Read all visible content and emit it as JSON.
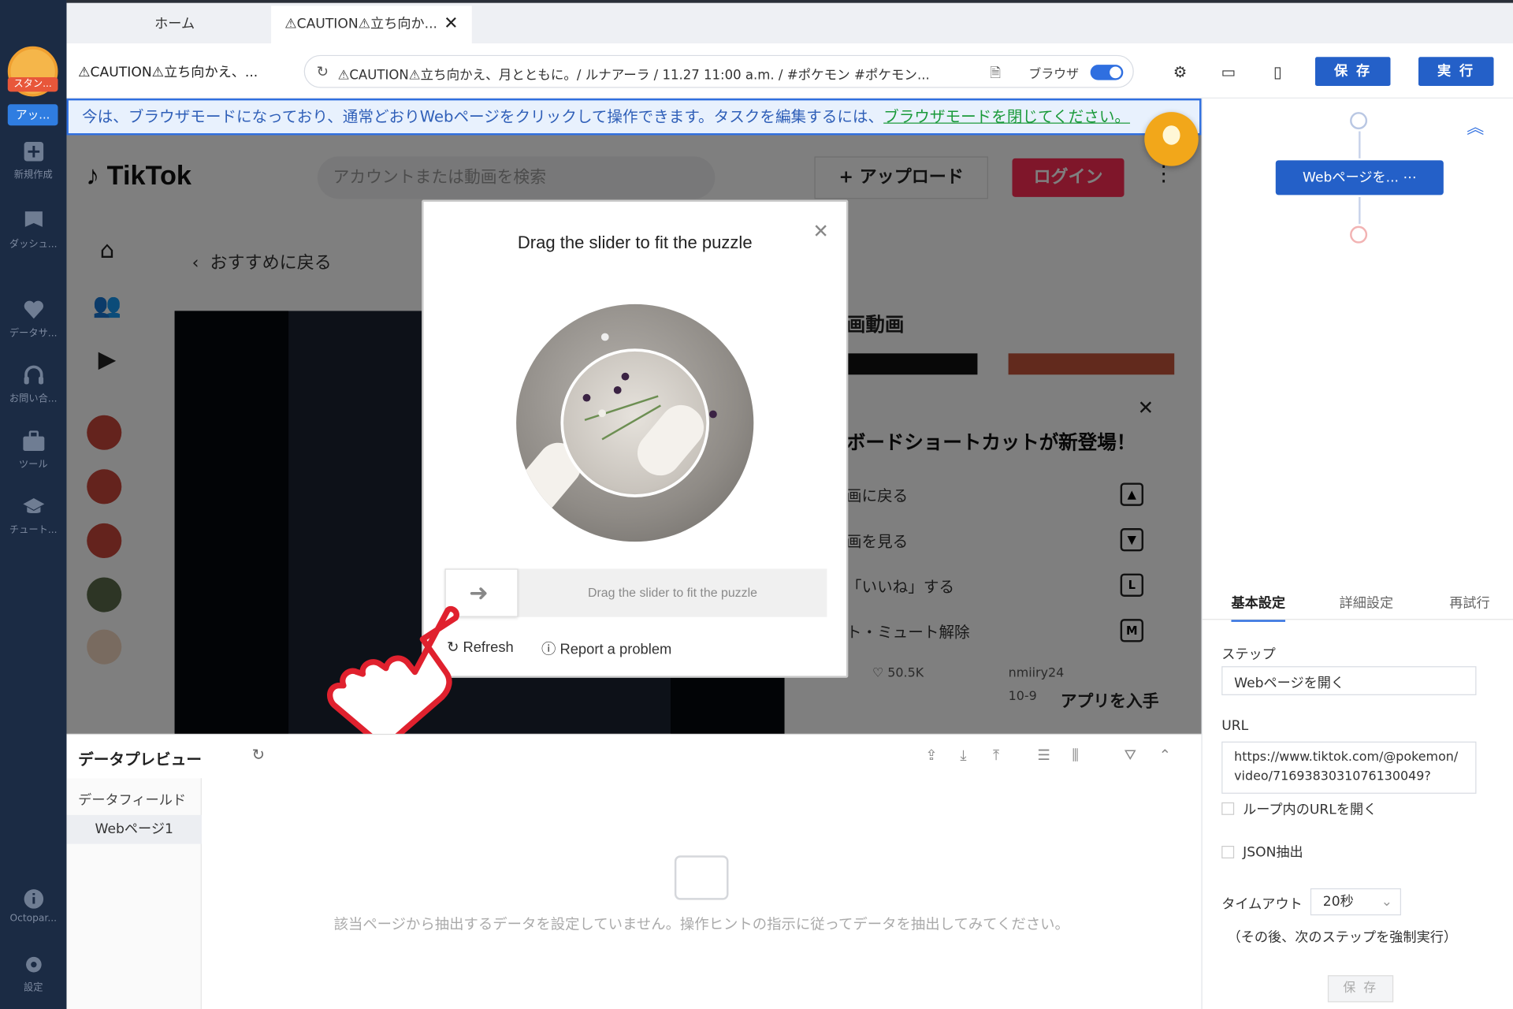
{
  "tabs": [
    {
      "label": "ホーム"
    },
    {
      "label": "⚠CAUTION⚠立ち向か..."
    }
  ],
  "address": {
    "page_title": "⚠CAUTION⚠立ち向かえ、...",
    "url": "⚠CAUTION⚠立ち向かえ、月とともに。/ ルナアーラ / 11.27 11:00 a.m. / #ポケモン #ポケモン...",
    "browser_label": "ブラウザ"
  },
  "toolbar": {
    "save_label": "保 存",
    "run_label": "実 行"
  },
  "sidebar": {
    "badge": "スタン...",
    "app": "アッ...",
    "items": [
      {
        "label": "新規作成",
        "icon": "plus-icon"
      },
      {
        "label": "ダッシュ...",
        "icon": "flag-icon"
      },
      {
        "label": "データサ...",
        "icon": "heart-icon"
      },
      {
        "label": "お問い合...",
        "icon": "headset-icon"
      },
      {
        "label": "ツール",
        "icon": "briefcase-icon"
      },
      {
        "label": "チュート...",
        "icon": "graduation-cap-icon"
      },
      {
        "label": "Octopar...",
        "icon": "info-icon"
      },
      {
        "label": "設定",
        "icon": "gear-icon"
      }
    ]
  },
  "infobar": {
    "text": "今は、ブラウザモードになっており、通常どおりWebページをクリックして操作できます。タスクを編集するには、",
    "link": "ブラウザモードを閉じてください。"
  },
  "tiktok": {
    "logo": "TikTok",
    "search_placeholder": "アカウントまたは動画を検索",
    "upload": "+ アップロード",
    "login": "ログイン",
    "back": "おすすめに戻る",
    "related": "画動画",
    "kb_title": "ボードショートカットが新登場！",
    "kb_rows": [
      {
        "label": "画に戻る",
        "key": "▲"
      },
      {
        "label": "画を見る",
        "key": "▼"
      },
      {
        "label": "「いいね」する",
        "key": "L"
      },
      {
        "label": "ト・ミュート解除",
        "key": "M"
      }
    ],
    "likes": "50.5K",
    "user": "nmiiry24",
    "date": "10-9",
    "get_app": "アプリを入手"
  },
  "captcha": {
    "title": "Drag the slider to fit the puzzle",
    "slider_hint": "Drag the slider to fit the puzzle",
    "refresh": "Refresh",
    "report": "Report a problem"
  },
  "data_preview": {
    "title": "データプレビュー",
    "field_label": "データフィールド",
    "page_label": "Webページ1",
    "empty": "該当ページから抽出するデータを設定していません。操作ヒントの指示に従ってデータを抽出してみてください。"
  },
  "right_panel": {
    "node_label": "Webページを...",
    "tabs": [
      {
        "label": "基本設定"
      },
      {
        "label": "詳細設定"
      },
      {
        "label": "再試行"
      }
    ],
    "step_label": "ステップ",
    "step_value": "Webページを開く",
    "url_label": "URL",
    "url_value": "https://www.tiktok.com/@pokemon/video/7169383031076130049?",
    "loop_label": "ループ内のURLを開く",
    "json_label": "JSON抽出",
    "timeout_label": "タイムアウト",
    "timeout_value": "20秒",
    "timeout_note": "（その後、次のステップを強制実行）",
    "save": "保 存"
  },
  "colors": {
    "accent": "#2460c8",
    "tiktok_red": "#fe2c55",
    "bulb": "#f2a71a",
    "sidebar": "#1b2b44"
  }
}
